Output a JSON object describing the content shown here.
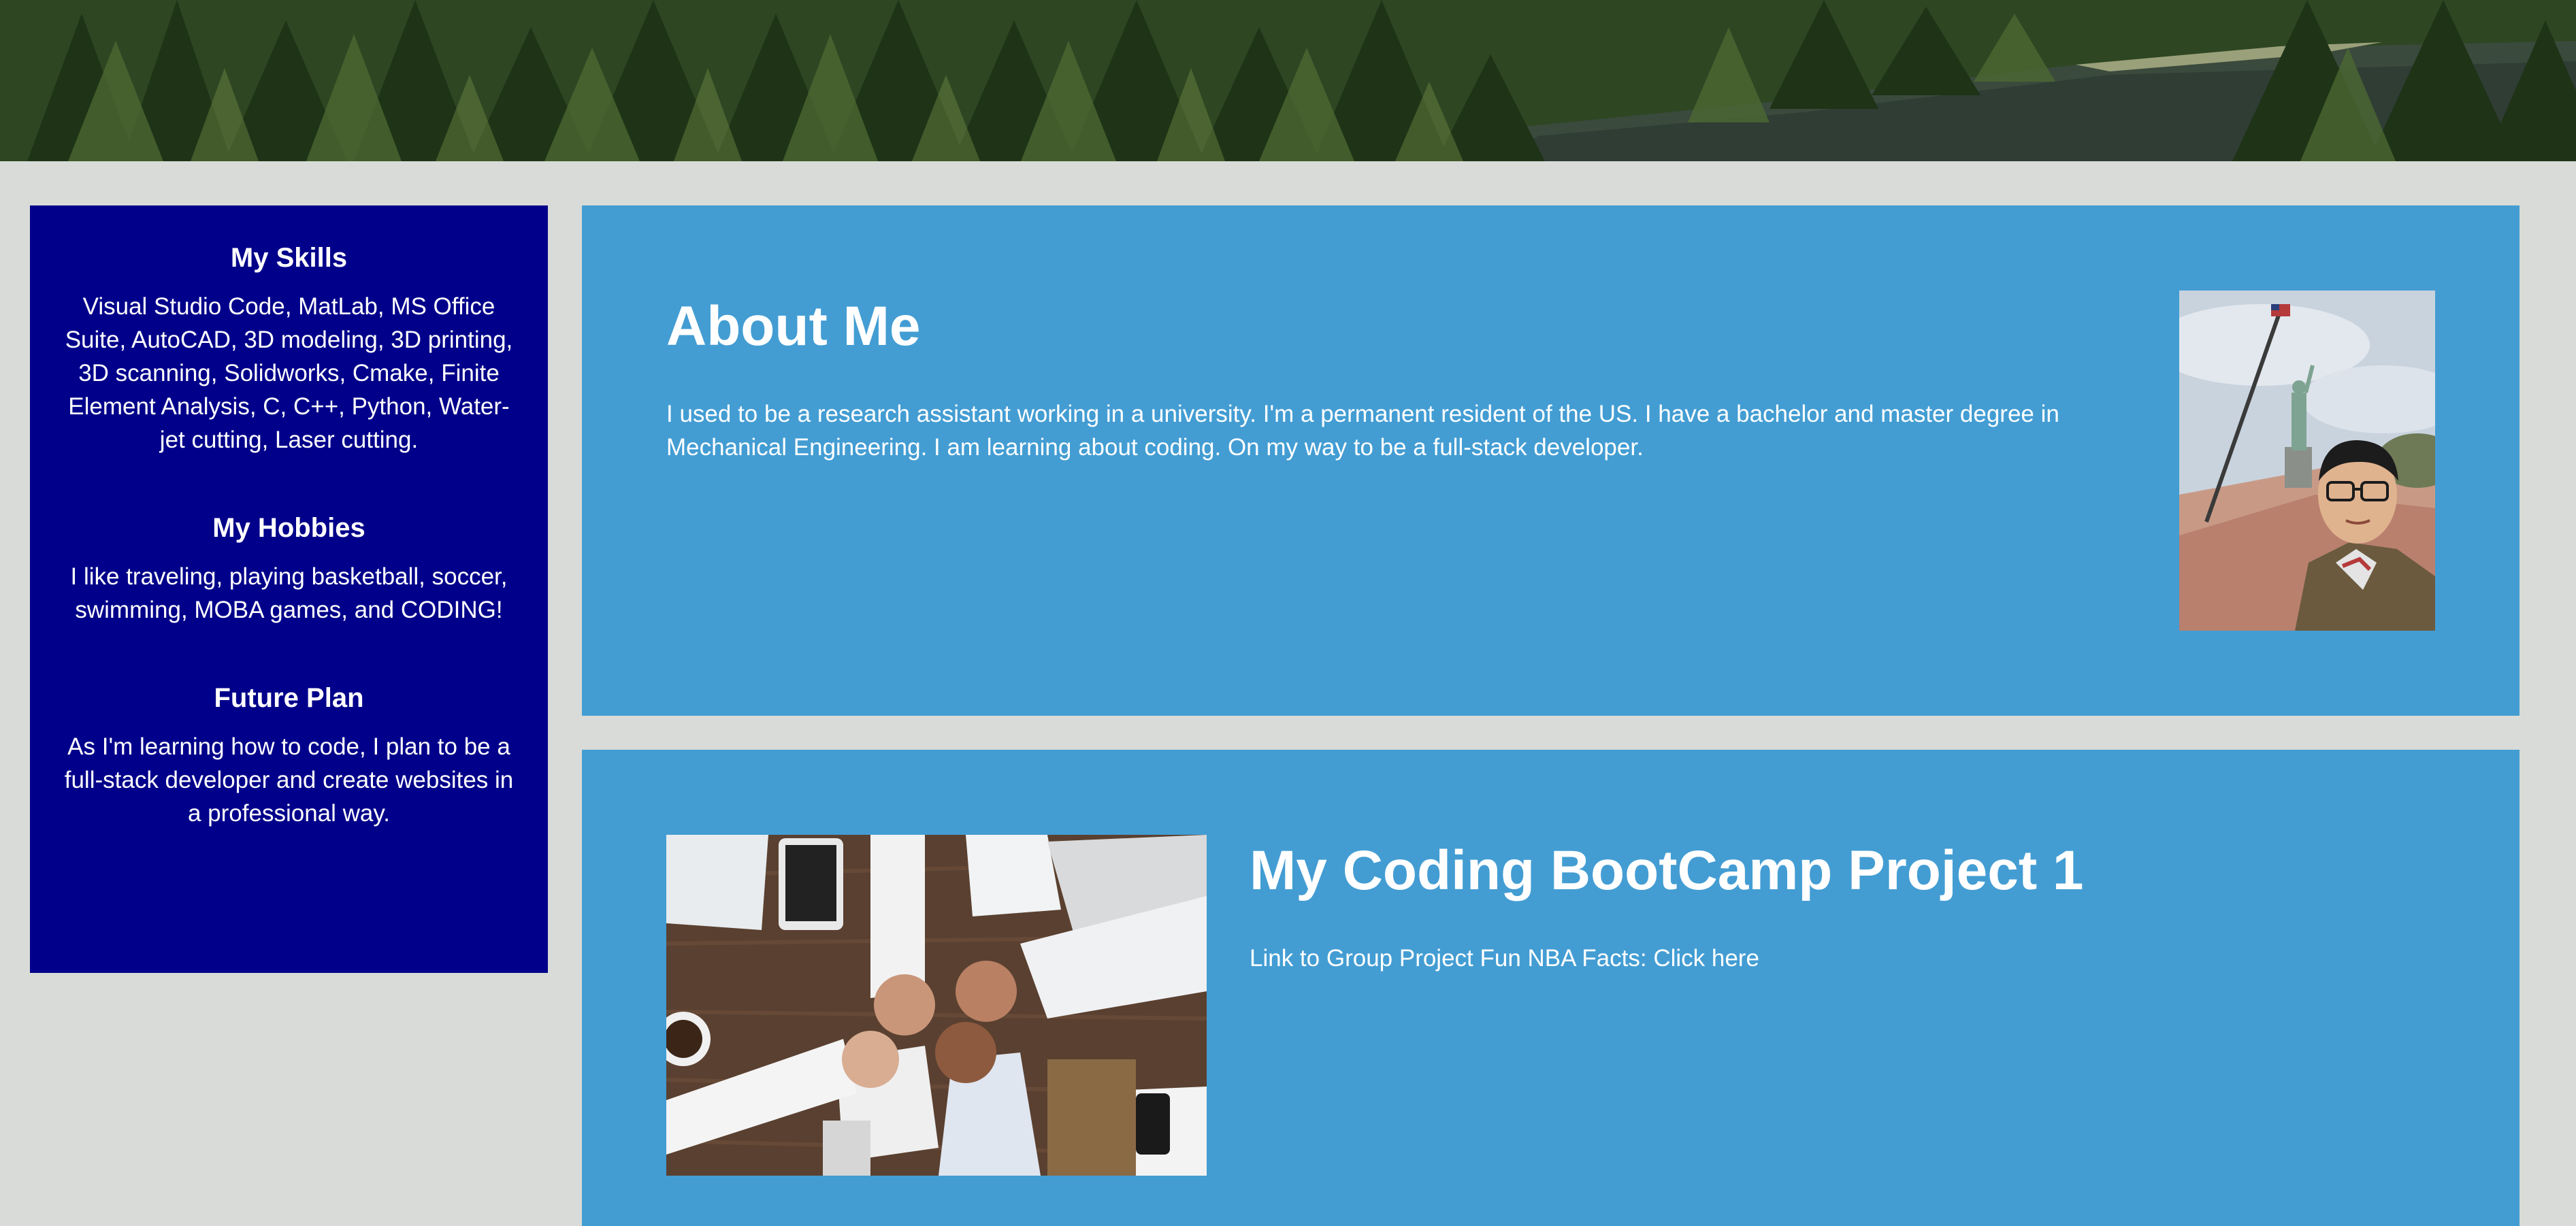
{
  "banner": {
    "image_alt": "forest-and-lake-banner"
  },
  "sidebar": {
    "sections": [
      {
        "title": "My Skills",
        "text": "Visual Studio Code, MatLab, MS Office Suite, AutoCAD, 3D modeling, 3D printing, 3D scanning, Solidworks, Cmake, Finite Element Analysis, C, C++, Python, Water-jet cutting, Laser cutting."
      },
      {
        "title": "My Hobbies",
        "text": "I like traveling, playing basketball, soccer, swimming, MOBA games, and CODING!"
      },
      {
        "title": "Future Plan",
        "text": "As I'm learning how to code, I plan to be a full-stack developer and create websites in a professional way."
      }
    ]
  },
  "about": {
    "title": "About Me",
    "text": "I used to be a research assistant working in a university. I'm a permanent resident of the US. I have a bachelor and master degree in Mechanical Engineering. I am learning about coding. On my way to be a full-stack developer."
  },
  "project": {
    "title": "My Coding BootCamp Project 1",
    "link_prefix": "Link to Group Project Fun NBA Facts: ",
    "link_text": "Click here"
  },
  "colors": {
    "page_background": "#d8dbd7",
    "sidebar_background": "#01008a",
    "card_background": "#439dd3",
    "text": "#ffffff"
  }
}
